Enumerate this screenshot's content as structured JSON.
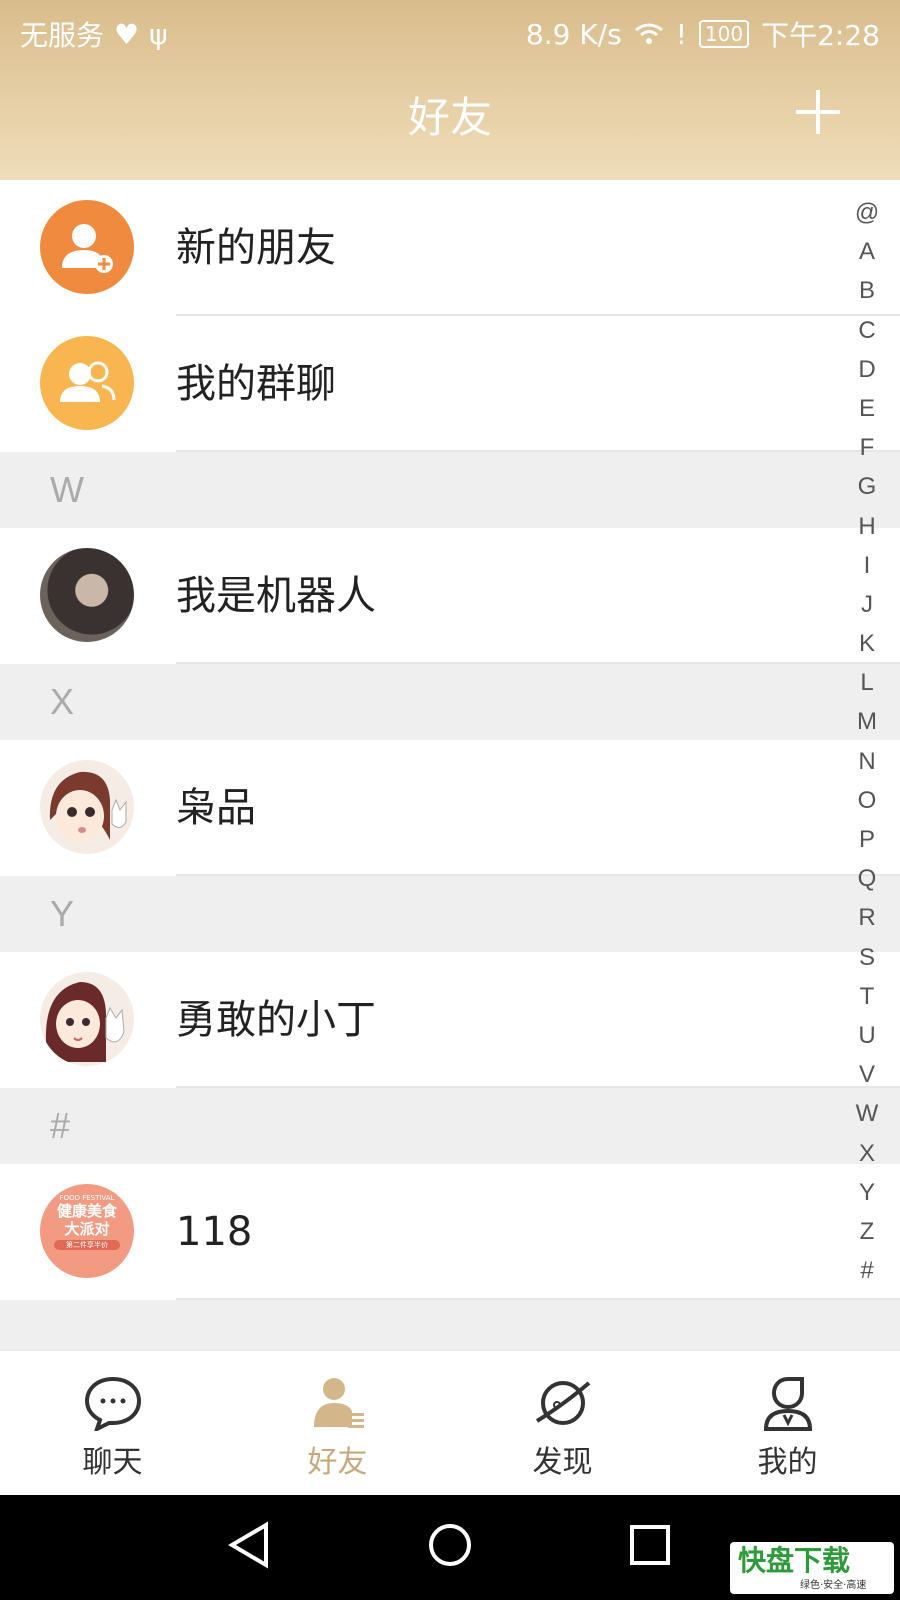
{
  "status_bar": {
    "carrier": "无服务",
    "speed": "8.9 K/s",
    "battery": "100",
    "time": "下午2:28"
  },
  "header": {
    "title": "好友"
  },
  "fixed_items": [
    {
      "label": "新的朋友",
      "icon": "add-friend-icon",
      "color": "#ef8a3f"
    },
    {
      "label": "我的群聊",
      "icon": "group-chat-icon",
      "color": "#f9b54f"
    }
  ],
  "sections": [
    {
      "letter": "W",
      "contacts": [
        {
          "name": "我是机器人",
          "avatar": "avatar-photo"
        }
      ]
    },
    {
      "letter": "X",
      "contacts": [
        {
          "name": "枭品",
          "avatar": "avatar-cartoon-girl"
        }
      ]
    },
    {
      "letter": "Y",
      "contacts": [
        {
          "name": "勇敢的小丁",
          "avatar": "avatar-cartoon-girl-cat"
        }
      ]
    },
    {
      "letter": "#",
      "contacts": [
        {
          "name": "118",
          "avatar": "avatar-food-poster",
          "avatar_text": [
            "FOOD FESTIVAL",
            "健康美食",
            "大派对",
            "第二件享半价"
          ]
        }
      ]
    }
  ],
  "index_letters": [
    "@",
    "A",
    "B",
    "C",
    "D",
    "E",
    "F",
    "G",
    "H",
    "I",
    "J",
    "K",
    "L",
    "M",
    "N",
    "O",
    "P",
    "Q",
    "R",
    "S",
    "T",
    "U",
    "V",
    "W",
    "X",
    "Y",
    "Z",
    "#"
  ],
  "tabs": [
    {
      "label": "聊天",
      "icon": "chat-bubble-icon",
      "active": false
    },
    {
      "label": "好友",
      "icon": "friends-icon",
      "active": true
    },
    {
      "label": "发现",
      "icon": "planet-icon",
      "active": false
    },
    {
      "label": "我的",
      "icon": "profile-icon",
      "active": false
    }
  ],
  "watermark": {
    "brand": "快盘下载",
    "tagline": "绿色·安全·高速"
  },
  "colors": {
    "accent": "#c7a97c",
    "header_top": "#d9bc8c",
    "header_bottom": "#efdcb9"
  }
}
